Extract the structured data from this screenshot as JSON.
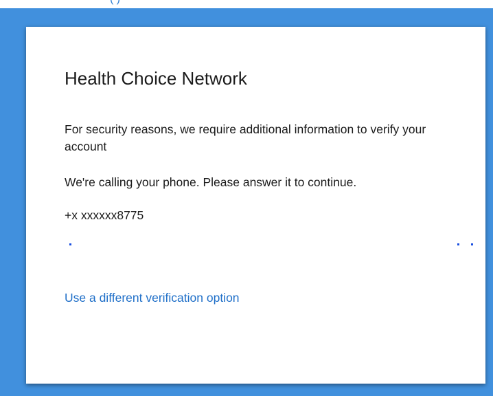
{
  "top_strip": {
    "partial_text": "( )"
  },
  "card": {
    "org_name": "Health Choice Network",
    "security_message": "For security reasons, we require additional information to verify your account",
    "call_message": "We're calling your phone. Please answer it to continue.",
    "phone_number": "+x xxxxxx8775",
    "alt_option_link": "Use a different verification option"
  },
  "progress": {
    "indicator": "animated-dots",
    "dot_count": 3
  },
  "colors": {
    "background": "#4190dd",
    "card": "#ffffff",
    "text": "#1b1b1b",
    "link": "#1f6fc8",
    "progress_dot": "#1a4fe0"
  }
}
